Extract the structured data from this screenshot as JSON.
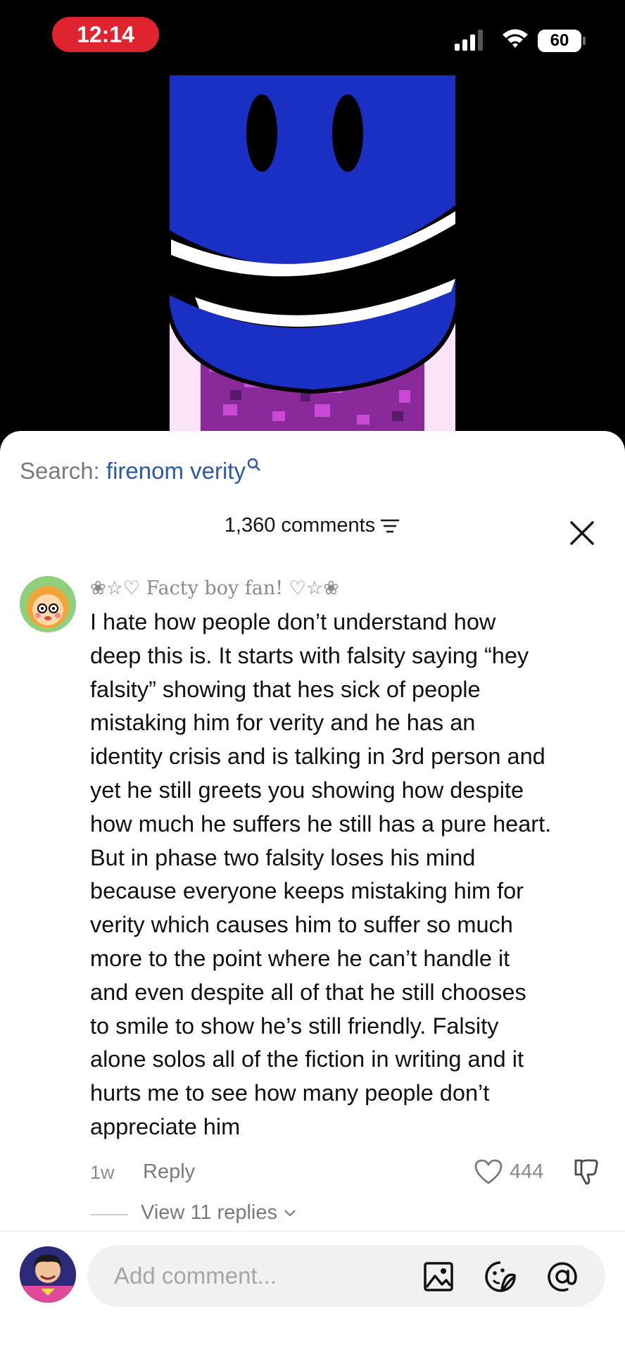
{
  "status_bar": {
    "time": "12:14",
    "battery": "60"
  },
  "search": {
    "label": "Search: ",
    "term": "firenom verity"
  },
  "comments": {
    "count_label": "1,360 comments"
  },
  "comment": {
    "username": "❀☆♡ Facty boy fan! ♡☆❀",
    "text": "I hate how people don’t understand how\ndeep this is. It starts with falsity saying “hey\nfalsity” showing that hes sick of people\nmistaking him for verity and he has an\nidentity crisis and is talking in 3rd person and\nyet he still greets you showing how despite\nhow much he suffers he still has a pure heart.\nBut in phase two falsity loses his mind\nbecause everyone keeps mistaking him for\nverity which causes him to suffer so much\nmore to the point where he can’t handle it\nand even despite all of that he still chooses\nto smile to show he’s still friendly. Falsity\nalone solos all of the fiction in writing and it\nhurts me to see how many people don’t\nappreciate him",
    "time": "1w",
    "reply_label": "Reply",
    "likes": "444",
    "view_replies_label": "View 11 replies"
  },
  "composer": {
    "placeholder": "Add comment..."
  },
  "icons": {
    "signal": "signal-icon",
    "wifi": "wifi-icon",
    "search": "search-icon",
    "filter": "filter-icon",
    "close": "close-icon",
    "like": "heart-icon",
    "dislike": "thumbs-down-icon",
    "chevron": "chevron-down-icon",
    "image": "image-icon",
    "sticker": "sticker-icon",
    "mention": "at-icon"
  },
  "colors": {
    "status_pill": "#e0242f",
    "search_term": "#2d58a3",
    "sheet_bg": "#ffffff",
    "face_blue": "#1a2fc4"
  }
}
